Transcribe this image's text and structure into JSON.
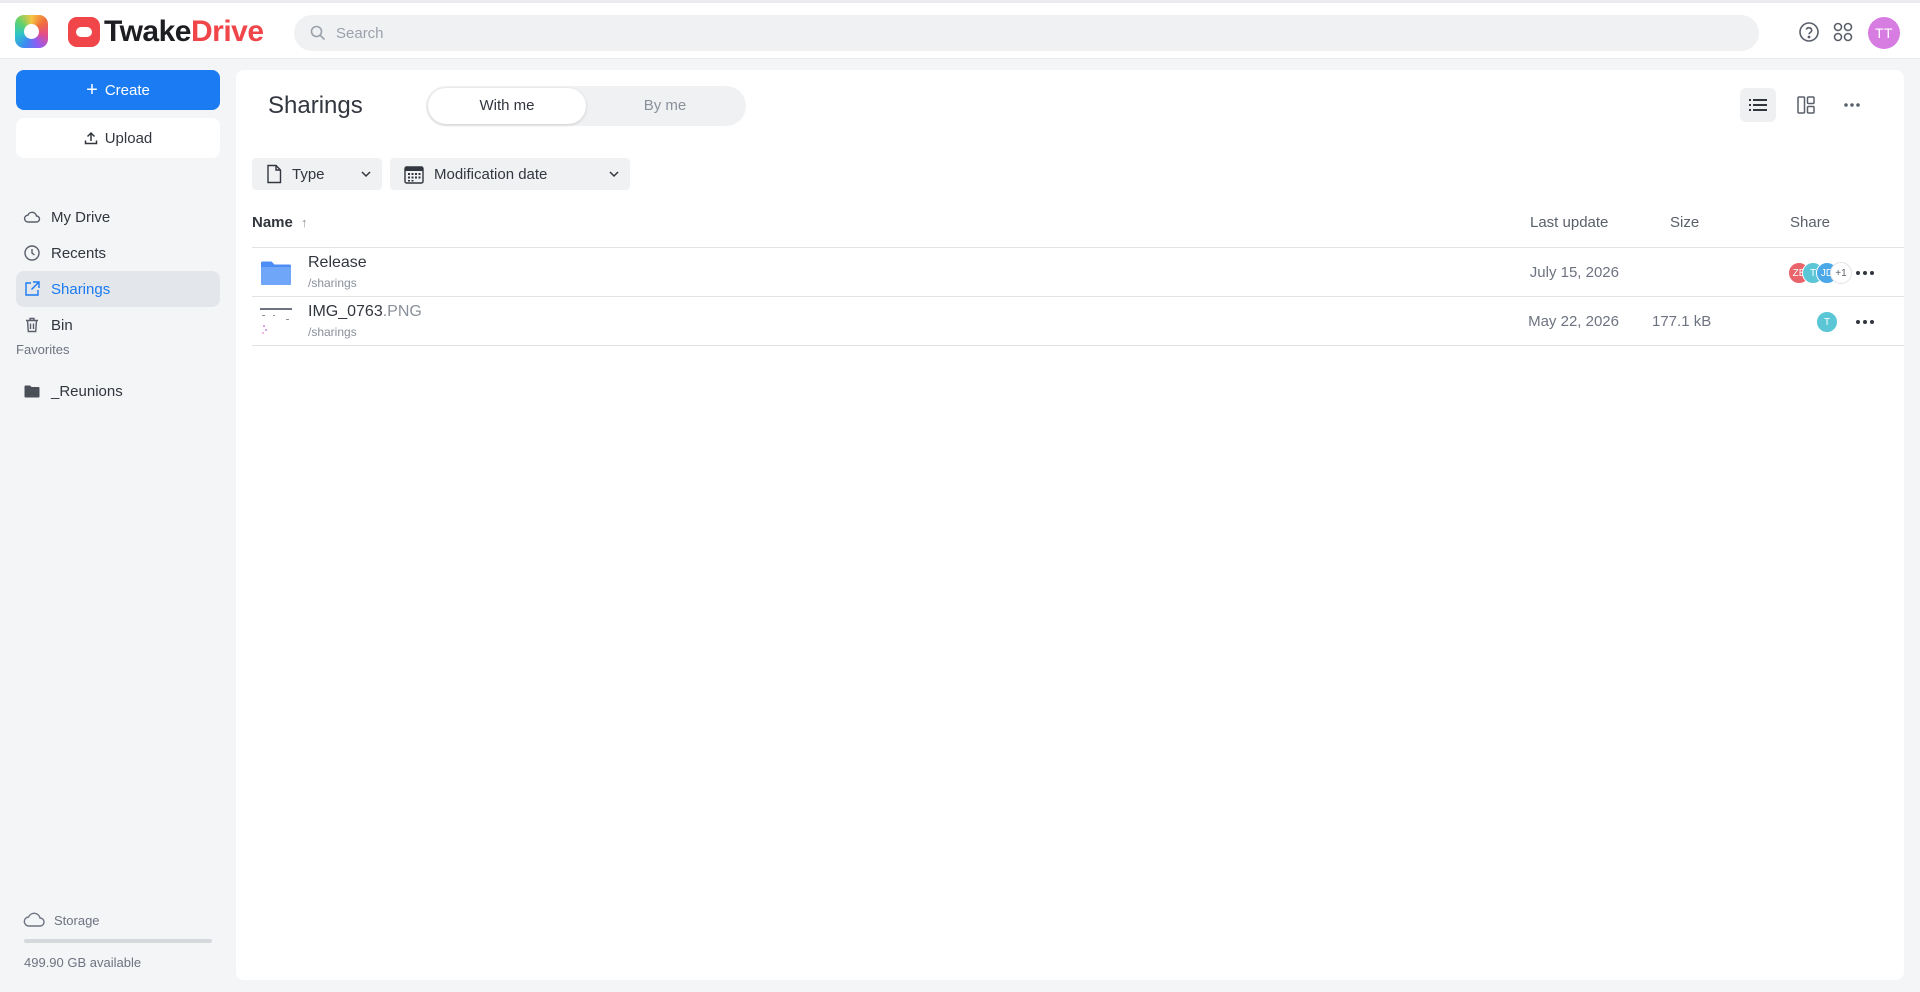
{
  "header": {
    "brand_part1": "Twake",
    "brand_part2": "Drive",
    "search_placeholder": "Search",
    "user_initials": "TT",
    "icons": [
      "app-switcher-icon",
      "help-icon",
      "apps-grid-icon"
    ]
  },
  "sidebar": {
    "create_label": "Create",
    "upload_label": "Upload",
    "nav": [
      {
        "label": "My Drive",
        "icon": "cloud-icon"
      },
      {
        "label": "Recents",
        "icon": "clock-icon"
      },
      {
        "label": "Sharings",
        "icon": "share-icon",
        "active": true
      },
      {
        "label": "Bin",
        "icon": "trash-icon"
      }
    ],
    "favorites_title": "Favorites",
    "favorites": [
      {
        "label": "_Reunions",
        "icon": "folder-icon"
      }
    ],
    "storage_label": "Storage",
    "storage_available": "499.90 GB available",
    "storage_used_fraction": 0.0
  },
  "main": {
    "title": "Sharings",
    "tabs": [
      {
        "label": "With me",
        "active": true
      },
      {
        "label": "By me",
        "active": false
      }
    ],
    "filters": {
      "type_label": "Type",
      "date_label": "Modification date"
    },
    "columns": {
      "name": "Name",
      "sort_indicator": "↑",
      "last_update": "Last update",
      "size": "Size",
      "share": "Share"
    },
    "rows": [
      {
        "name": "Release",
        "ext": "",
        "path": "/sharings",
        "last_update": "July 15, 2026",
        "size": "",
        "type": "folder",
        "share": [
          {
            "initials": "ZB",
            "color": "#e8636a"
          },
          {
            "initials": "T",
            "color": "#5bc6d6"
          },
          {
            "initials": "JD",
            "color": "#4aa7e8"
          },
          {
            "initials": "+1",
            "color": "#ffffff"
          }
        ]
      },
      {
        "name": "IMG_0763",
        "ext": ".PNG",
        "path": "/sharings",
        "last_update": "May 22, 2026",
        "size": "177.1 kB",
        "type": "image",
        "share": [
          {
            "initials": "T",
            "color": "#5bc6d6"
          }
        ]
      }
    ]
  },
  "colors": {
    "accent": "#1a7bf2",
    "brand_red": "#f0464a",
    "user_avatar": "#d77de2"
  }
}
